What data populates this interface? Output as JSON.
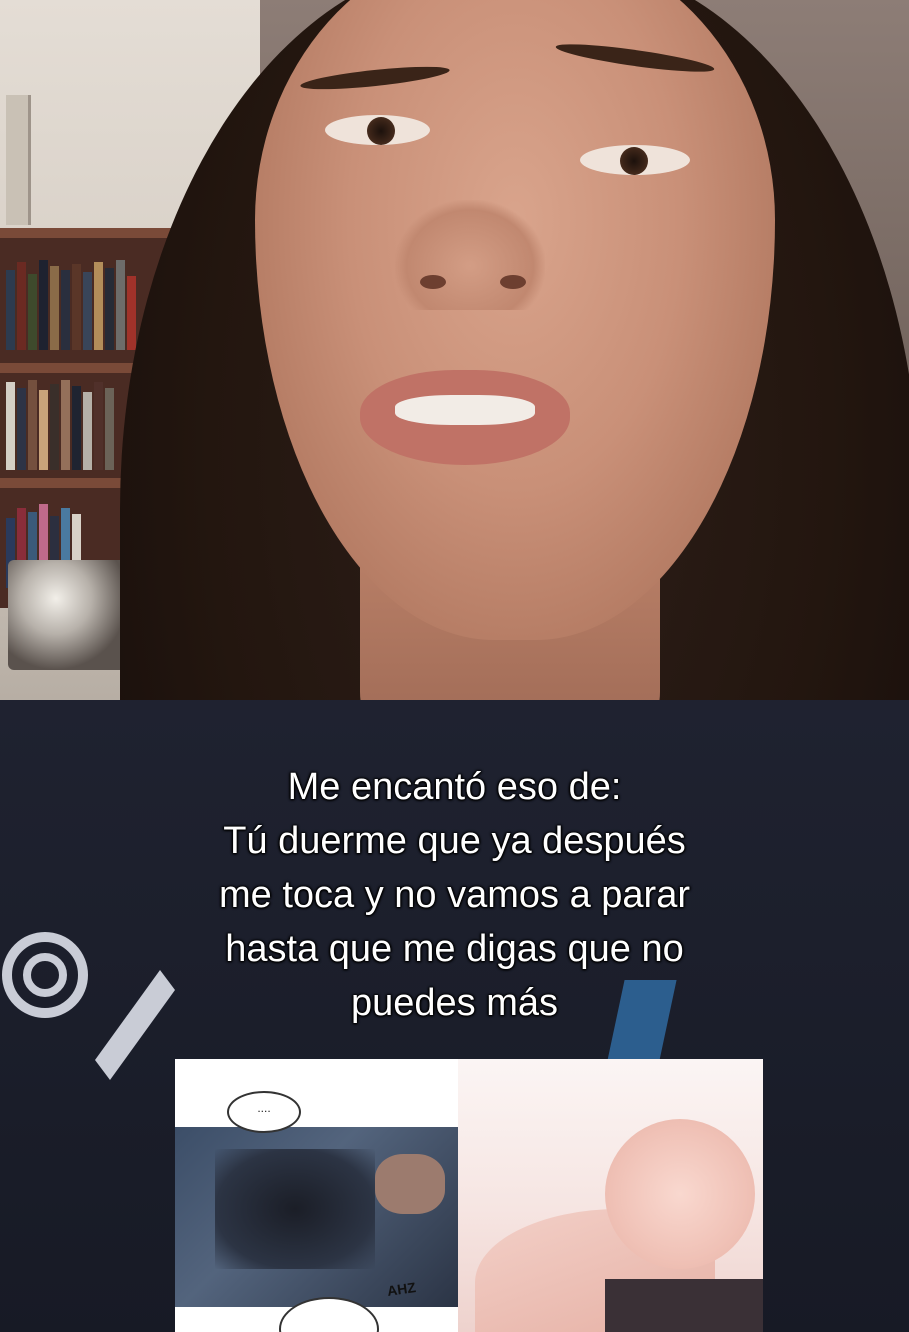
{
  "caption": {
    "lines": [
      "Me encantó eso de:",
      "Tú duerme que ya después",
      "me toca y no vamos a parar",
      "hasta que me digas que no",
      "puedes más"
    ]
  },
  "comic": {
    "bubble_text": "....",
    "sfx_text": "AHZ"
  },
  "colors": {
    "caption_text": "#ffffff",
    "hair": "#23160f",
    "shirt": "#1f2230",
    "shelf": "#4a2b23"
  }
}
